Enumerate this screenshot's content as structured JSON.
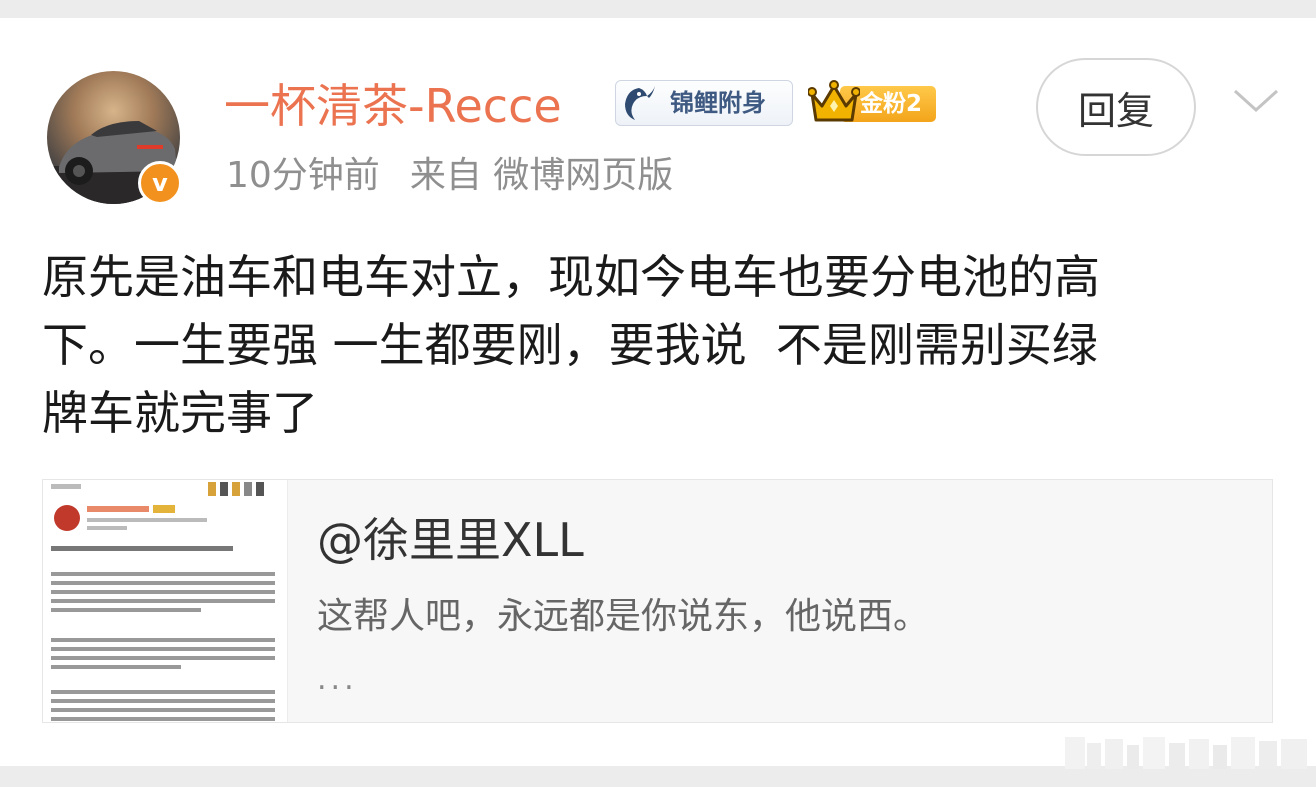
{
  "post": {
    "username": "一杯清茶-Recce",
    "badges": {
      "koi": "锦鲤附身",
      "fan": "金粉2"
    },
    "reply_label": "回复",
    "meta": {
      "time": "10分钟前",
      "source": "来自 微博网页版"
    },
    "text": "原先是油车和电车对立，现如今电车也要分电池的高\n下。一生要强 一生都要刚，要我说  不是刚需别买绿\n牌车就完事了"
  },
  "quote": {
    "author": "@徐里里XLL",
    "text": "这帮人吧，永远都是你说东，他说西。",
    "ellipsis": "..."
  },
  "colors": {
    "username": "#eb7350",
    "verified_badge": "#f3911f",
    "meta_text": "#8f8f8f",
    "body_text": "#1a1a1a",
    "quote_background": "#f7f7f7"
  },
  "icons": {
    "verified": "verified-v-icon",
    "koi": "koi-fish-icon",
    "crown": "crown-icon",
    "more": "chevron-down-icon"
  }
}
